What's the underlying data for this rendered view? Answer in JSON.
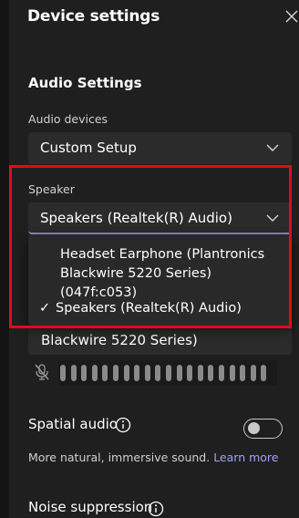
{
  "header": {
    "title": "Device settings",
    "close_icon": "close-icon"
  },
  "audio": {
    "section_title": "Audio Settings",
    "devices_label": "Audio devices",
    "devices_value": "Custom Setup",
    "speaker_label": "Speaker",
    "speaker_value": "Speakers (Realtek(R) Audio)",
    "speaker_options": [
      {
        "label": "Headset Earphone (Plantronics Blackwire 5220 Series) (047f:c053)",
        "selected": false
      },
      {
        "label": "Speakers (Realtek(R) Audio)",
        "selected": true
      }
    ],
    "check_mark": "✓",
    "microphone_partial": "Blackwire 5220 Series)",
    "mic_icon": "mic-muted-icon",
    "mic_level": 0
  },
  "spatial": {
    "label": "Spatial audio",
    "enabled": false,
    "description": "More natural, immersive sound.",
    "link": "Learn more"
  },
  "noise": {
    "label": "Noise suppression"
  },
  "colors": {
    "background": "#1f1f1f",
    "accent": "#9ea2ff",
    "highlight": "#e10b18"
  }
}
